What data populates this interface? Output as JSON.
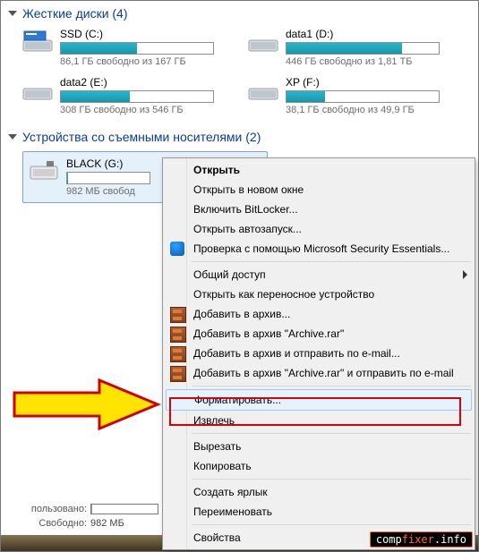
{
  "sections": {
    "hdd": {
      "title": "Жесткие диски (4)"
    },
    "removable": {
      "title": "Устройства со съемными носителями (2)"
    }
  },
  "drives": [
    {
      "name": "SSD (C:)",
      "sub": "86,1 ГБ свободно из 167 ГБ",
      "fill": 50
    },
    {
      "name": "data1 (D:)",
      "sub": "446 ГБ свободно из 1,81 ТБ",
      "fill": 76
    },
    {
      "name": "data2 (E:)",
      "sub": "308 ГБ свободно из 546 ГБ",
      "fill": 45
    },
    {
      "name": "XP (F:)",
      "sub": "38,1 ГБ свободно из 49,9 ГБ",
      "fill": 25
    }
  ],
  "removable": {
    "name": "BLACK (G:)",
    "sub": "982 МБ свобод",
    "fill": 1
  },
  "menu": {
    "open": "Открыть",
    "open_new": "Открыть в новом окне",
    "bitlocker": "Включить BitLocker...",
    "autoplay": "Открыть автозапуск...",
    "mse": "Проверка с помощью Microsoft Security Essentials...",
    "share": "Общий доступ",
    "portable": "Открыть как переносное устройство",
    "rar_add": "Добавить в архив...",
    "rar_add_named": "Добавить в архив \"Archive.rar\"",
    "rar_mail": "Добавить в архив и отправить по e-mail...",
    "rar_named_mail": "Добавить в архив \"Archive.rar\" и отправить по e-mail",
    "format": "Форматировать...",
    "eject": "Извлечь",
    "cut": "Вырезать",
    "copy": "Копировать",
    "shortcut": "Создать ярлык",
    "rename": "Переименовать",
    "properties": "Свойства"
  },
  "status": {
    "used_label": "пользовано:",
    "used_pct": 1,
    "free_label": "Свободно:",
    "free_value": "982 МБ"
  },
  "badge": {
    "a": "comp",
    "b": "fixer",
    "c": ".info"
  }
}
